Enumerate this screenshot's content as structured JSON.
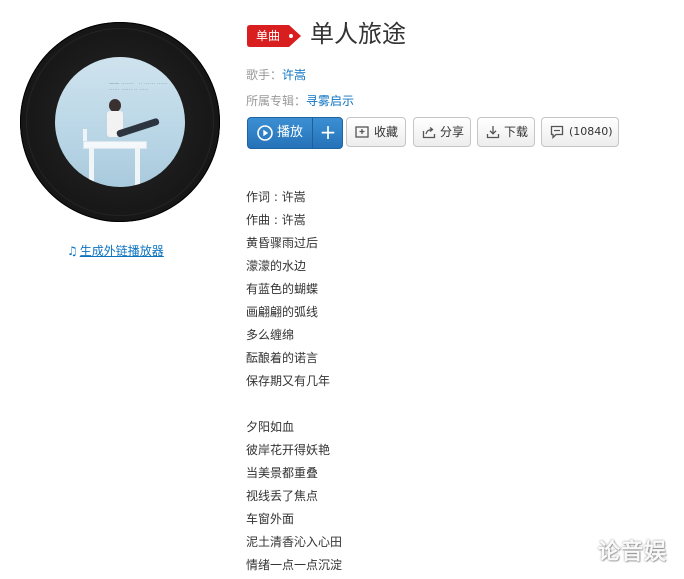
{
  "album_art": {
    "cover_text_lines": [
      "—— ·······　·· ······ ······",
      "······ ······ ·· ·····"
    ]
  },
  "ext_player_link": "生成外链播放器",
  "song": {
    "badge": "单曲",
    "title": "单人旅途",
    "artist_label": "歌手：",
    "artist": "许嵩",
    "album_label": "所属专辑：",
    "album": "寻雾启示"
  },
  "actions": {
    "play": "播放",
    "add": "+",
    "collect": "收藏",
    "share": "分享",
    "download": "下载",
    "comment_count": "(10840)"
  },
  "lyrics": [
    "作词 : 许嵩",
    "作曲 : 许嵩",
    "黄昏骤雨过后",
    "濛濛的水边",
    "有蓝色的蝴蝶",
    "画翩翩的弧线",
    "多么缠绵",
    "酝酿着的诺言",
    "保存期又有几年",
    "",
    "夕阳如血",
    "彼岸花开得妖艳",
    "当美景都重叠",
    "视线丢了焦点",
    "车窗外面",
    "泥土清香沁入心田",
    "情绪一点一点沉淀"
  ],
  "watermark": "论音娱",
  "colors": {
    "badge_red": "#d81e1e",
    "link_blue": "#0c73c2",
    "play_blue": "#2b7bc4"
  }
}
